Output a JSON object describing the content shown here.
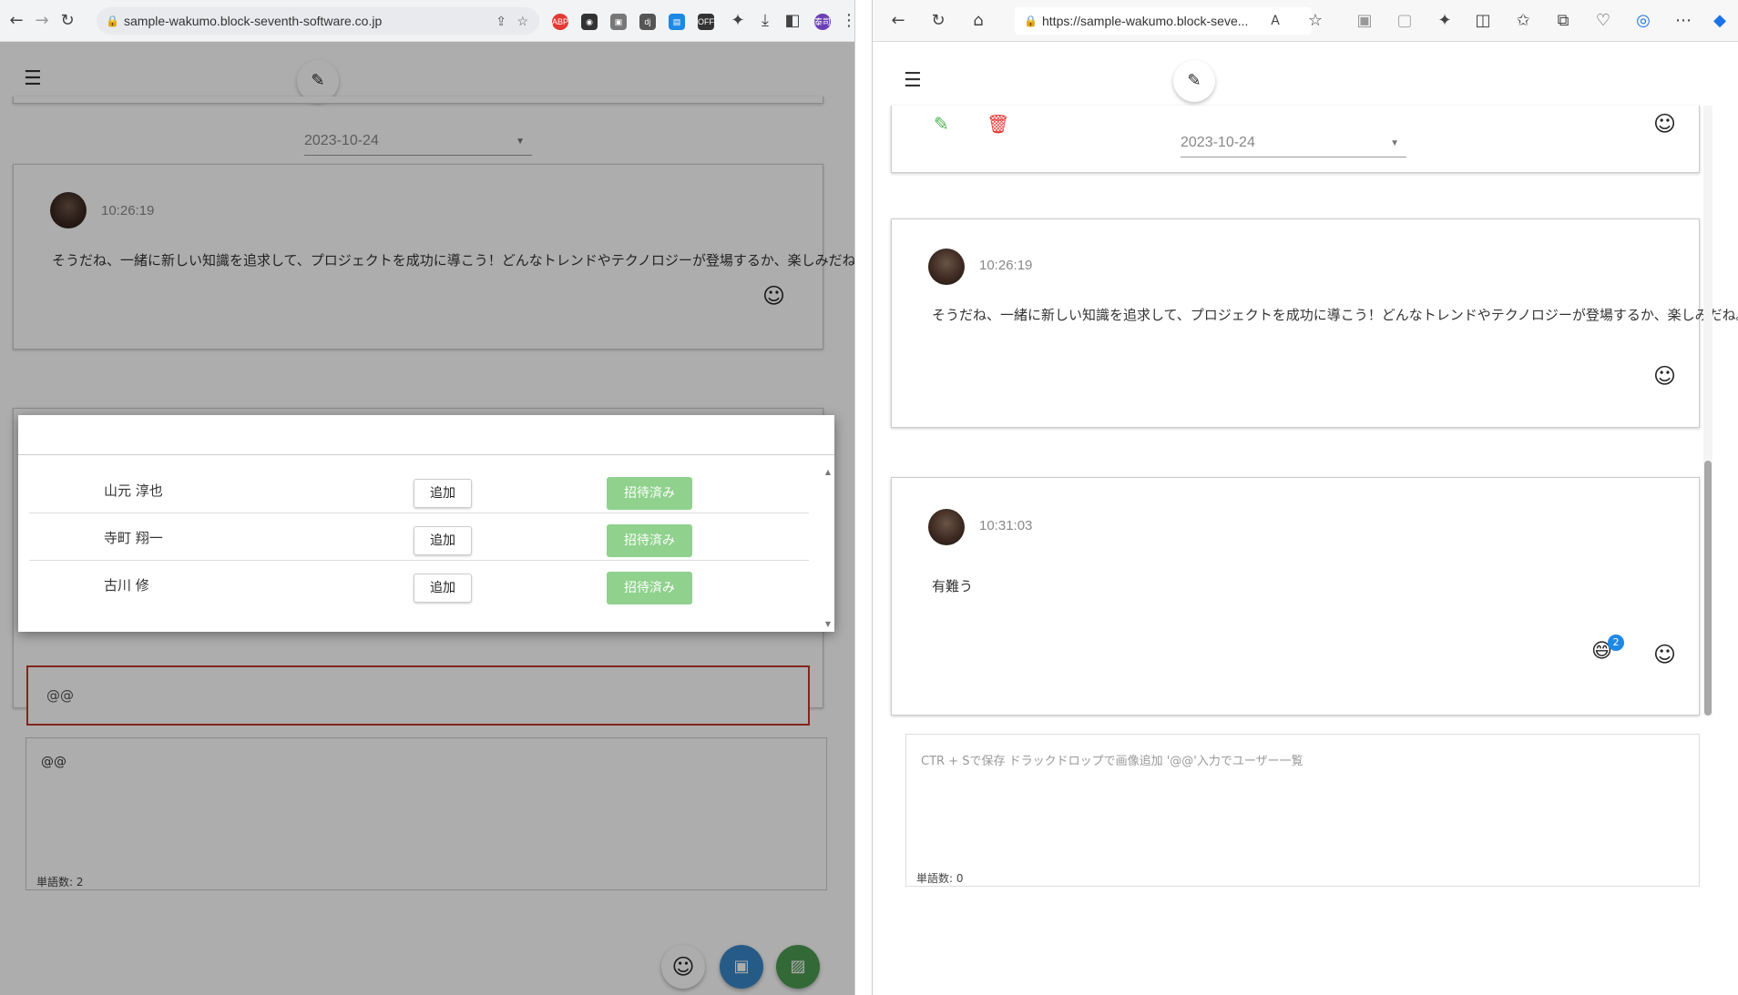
{
  "left": {
    "url": "sample-wakumo.block-seventh-software.co.jp",
    "date": "2023-10-24",
    "message": {
      "time": "10:26:19",
      "text": "そうだね、一緒に新しい知識を追求して、プロジェクトを成功に導こう！どんなトレンドやテクノロジーが登場するか、楽しみだね。"
    },
    "user_modal": {
      "users": [
        {
          "name": "山元 淳也",
          "add": "追加",
          "invite": "招待済み"
        },
        {
          "name": "寺町 翔一",
          "add": "追加",
          "invite": "招待済み"
        },
        {
          "name": "古川 修",
          "add": "追加",
          "invite": "招待済み"
        }
      ]
    },
    "mention_input": "@@",
    "editor_text": "@@",
    "word_count": "単語数: 2"
  },
  "right": {
    "url": "https://sample-wakumo.block-seve...",
    "date": "2023-10-24",
    "messages": [
      {
        "time": "10:26:19",
        "text": "そうだね、一緒に新しい知識を追求して、プロジェクトを成功に導こう！どんなトレンドやテクノロジーが登場するか、楽しみだね。"
      },
      {
        "time": "10:31:03",
        "text": "有難う",
        "reaction_count": "2"
      }
    ],
    "editor_placeholder": "CTR + Sで保存 ドラックドロップで画像追加 '@@'入力でユーザー一覧",
    "word_count": "単語数: 0"
  },
  "colors": {
    "save": "#3a87c8",
    "image": "#4c9a52",
    "invite": "#8fd18d",
    "delete": "#e53935",
    "edit_green": "#4caf50",
    "mention_border": "#c0392b"
  }
}
